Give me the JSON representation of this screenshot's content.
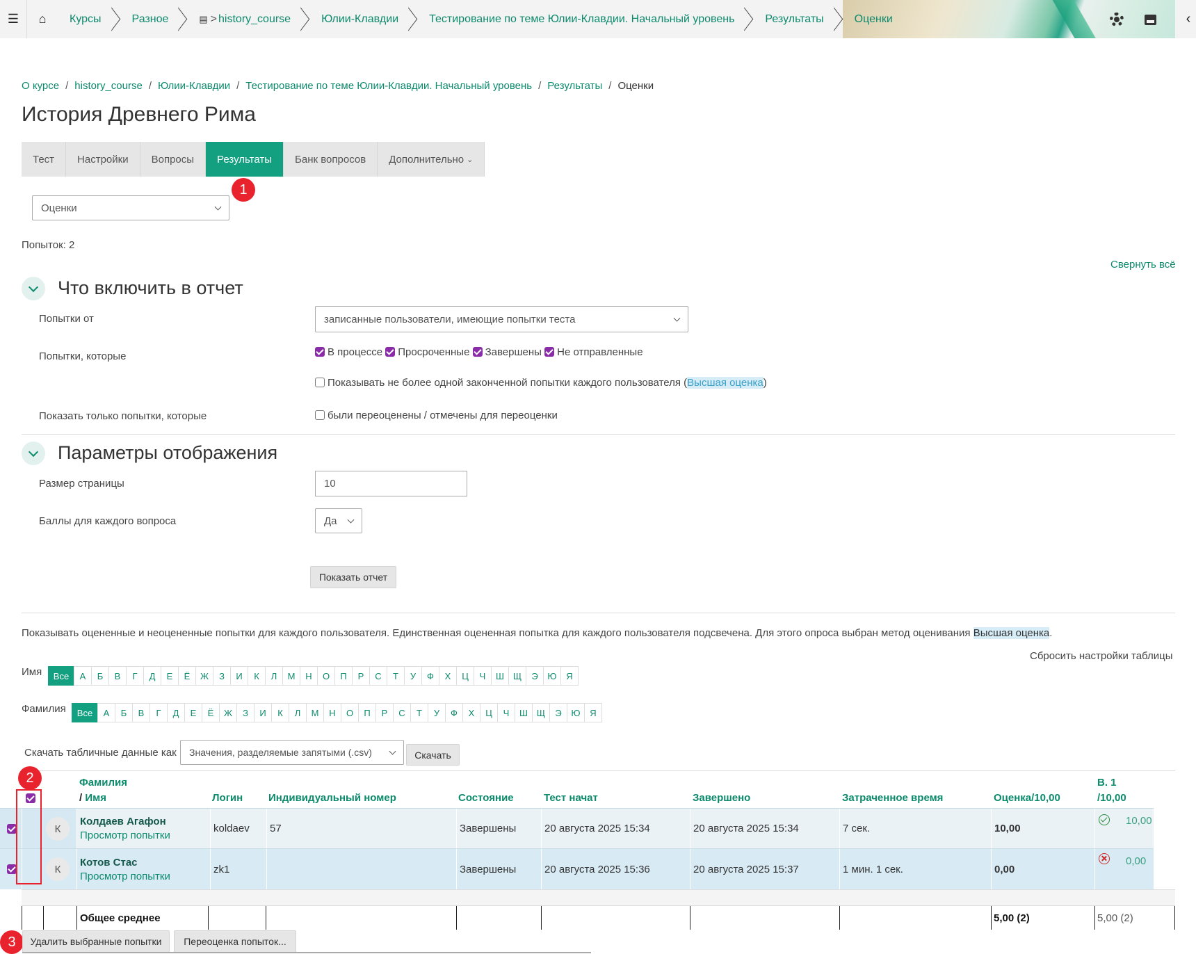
{
  "topnav": {
    "crumbs": [
      "Курсы",
      "Разное",
      "history_course",
      "Юлии-Клавдии",
      "Тестирование по теме Юлии-Клавдии. Начальный уровень",
      "Результаты",
      "Оценки"
    ]
  },
  "breadcrumb": [
    "О курсе",
    "history_course",
    "Юлии-Клавдии",
    "Тестирование по теме Юлии-Клавдии. Начальный уровень",
    "Результаты",
    "Оценки"
  ],
  "page_title": "История Древнего Рима",
  "tabs": [
    "Тест",
    "Настройки",
    "Вопросы",
    "Результаты",
    "Банк вопросов",
    "Дополнительно"
  ],
  "report_select": "Оценки",
  "attempts_count": "Попыток: 2",
  "collapse_all": "Свернуть всё",
  "section1": {
    "title": "Что включить в отчет",
    "attempts_from_label": "Попытки от",
    "attempts_from_value": "записанные пользователи, имеющие попытки теста",
    "attempts_which_label": "Попытки, которые",
    "states": [
      "В процессе",
      "Просроченные",
      "Завершены",
      "Не отправленные"
    ],
    "one_attempt_text": "Показывать не более одной законченной попытки каждого пользователя (",
    "one_attempt_link": "Высшая оценка",
    "one_attempt_close": ")",
    "only_label": "Показать только попытки, которые",
    "only_text": "были переоценены / отмечены для переоценки"
  },
  "section2": {
    "title": "Параметры отображения",
    "page_size_label": "Размер страницы",
    "page_size_value": "10",
    "marks_label": "Баллы для каждого вопроса",
    "marks_value": "Да",
    "show_report": "Показать отчет"
  },
  "info_text": "Показывать оцененные и неоцененные попытки для каждого пользователя. Единственная оцененная попытка для каждого пользователя подсвечена. Для этого опроса выбран метод оценивания ",
  "info_link": "Высшая оценка",
  "info_end": ".",
  "reset_table": "Сбросить настройки таблицы",
  "firstname_label": "Имя",
  "lastname_label": "Фамилия",
  "all_label": "Все",
  "letters": [
    "А",
    "Б",
    "В",
    "Г",
    "Д",
    "Е",
    "Ё",
    "Ж",
    "З",
    "И",
    "К",
    "Л",
    "М",
    "Н",
    "О",
    "П",
    "Р",
    "С",
    "Т",
    "У",
    "Ф",
    "Х",
    "Ц",
    "Ч",
    "Ш",
    "Щ",
    "Э",
    "Ю",
    "Я"
  ],
  "download_label": "Скачать табличные данные как",
  "download_format": "Значения, разделяемые запятыми (.csv)",
  "download_button": "Скачать",
  "table": {
    "headers": {
      "lastname": "Фамилия",
      "slash": "/ ",
      "firstname": "Имя",
      "login": "Логин",
      "idnumber": "Индивидуальный номер",
      "state": "Состояние",
      "started": "Тест начат",
      "finished": "Завершено",
      "duration": "Затраченное время",
      "grade": "Оценка/10,00",
      "q1_a": "В. 1",
      "q1_b": "/10,00"
    },
    "rows": [
      {
        "avatar": "К",
        "name": "Колдаев Агафон",
        "review": "Просмотр попытки",
        "login": "koldaev",
        "idnumber": "57",
        "state": "Завершены",
        "started": "20 августа 2025 15:34",
        "finished": "20 августа 2025 15:34",
        "duration": "7 сек.",
        "grade": "10,00",
        "q1": "10,00"
      },
      {
        "avatar": "К",
        "name": "Котов Стас",
        "review": "Просмотр попытки",
        "login": "zk1",
        "idnumber": "",
        "state": "Завершены",
        "started": "20 августа 2025 15:36",
        "finished": "20 августа 2025 15:37",
        "duration": "1 мин. 1 сек.",
        "grade": "0,00",
        "q1": "0,00"
      }
    ],
    "overall_label": "Общее среднее",
    "overall_grade": "5,00 (2)",
    "overall_q1": "5,00 (2)"
  },
  "delete_button": "Удалить выбранные попытки",
  "regrade_button": "Переоценка попыток...",
  "markers": [
    "1",
    "2",
    "3"
  ],
  "colors": {
    "accent": "#12a080",
    "link": "#0c8a6c",
    "checkbox": "#8a2ba7",
    "marker": "#e8232d"
  }
}
